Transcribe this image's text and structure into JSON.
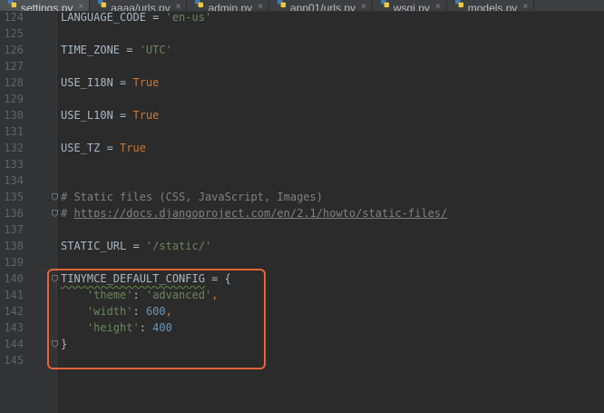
{
  "tabs": [
    {
      "label": "settings.py",
      "active": true
    },
    {
      "label": "aaaa/urls.py",
      "active": false
    },
    {
      "label": "admin.py",
      "active": false
    },
    {
      "label": "app01/urls.py",
      "active": false
    },
    {
      "label": "wsgi.py",
      "active": false
    },
    {
      "label": "models.py",
      "active": false
    }
  ],
  "close_glyph": "×",
  "editor": {
    "lines": [
      {
        "n": "124",
        "tokens": [
          [
            "ident",
            "LANGUAGE_CODE = "
          ],
          [
            "str",
            "'en-us'"
          ]
        ]
      },
      {
        "n": "125",
        "tokens": []
      },
      {
        "n": "126",
        "tokens": [
          [
            "ident",
            "TIME_ZONE = "
          ],
          [
            "str",
            "'UTC'"
          ]
        ]
      },
      {
        "n": "127",
        "tokens": []
      },
      {
        "n": "128",
        "tokens": [
          [
            "ident",
            "USE_I18N = "
          ],
          [
            "kw",
            "True"
          ]
        ]
      },
      {
        "n": "129",
        "tokens": []
      },
      {
        "n": "130",
        "tokens": [
          [
            "ident",
            "USE_L10N = "
          ],
          [
            "kw",
            "True"
          ]
        ]
      },
      {
        "n": "131",
        "tokens": []
      },
      {
        "n": "132",
        "tokens": [
          [
            "ident",
            "USE_TZ = "
          ],
          [
            "kw",
            "True"
          ]
        ]
      },
      {
        "n": "133",
        "tokens": []
      },
      {
        "n": "134",
        "tokens": []
      },
      {
        "n": "135",
        "fold": true,
        "tokens": [
          [
            "cmt",
            "# Static files (CSS, JavaScript, Images)"
          ]
        ]
      },
      {
        "n": "136",
        "fold": true,
        "tokens": [
          [
            "cmt",
            "# "
          ],
          [
            "link",
            "https://docs.djangoproject.com/en/2.1/howto/static-files/"
          ]
        ]
      },
      {
        "n": "137",
        "tokens": []
      },
      {
        "n": "138",
        "tokens": [
          [
            "ident",
            "STATIC_URL = "
          ],
          [
            "str",
            "'/static/'"
          ]
        ]
      },
      {
        "n": "139",
        "tokens": []
      },
      {
        "n": "140",
        "fold": true,
        "tokens": [
          [
            "squiggle",
            "TINYMCE_DEFAULT_CONFIG"
          ],
          [
            "ident",
            " = {"
          ]
        ]
      },
      {
        "n": "141",
        "tokens": [
          [
            "ident",
            "    "
          ],
          [
            "str",
            "'theme'"
          ],
          [
            "ident",
            ": "
          ],
          [
            "str",
            "'advanced'"
          ],
          [
            "kw",
            ","
          ]
        ]
      },
      {
        "n": "142",
        "tokens": [
          [
            "ident",
            "    "
          ],
          [
            "str",
            "'width'"
          ],
          [
            "ident",
            ": "
          ],
          [
            "num",
            "600"
          ],
          [
            "kw",
            ","
          ]
        ]
      },
      {
        "n": "143",
        "tokens": [
          [
            "ident",
            "    "
          ],
          [
            "str",
            "'height'"
          ],
          [
            "ident",
            ": "
          ],
          [
            "num",
            "400"
          ]
        ]
      },
      {
        "n": "144",
        "fold": true,
        "tokens": [
          [
            "ident",
            "}"
          ]
        ]
      },
      {
        "n": "145",
        "tokens": []
      }
    ]
  },
  "colors": {
    "background": "#2b2b2b",
    "keyword": "#cc7832",
    "string": "#6a8759",
    "number": "#6897bb",
    "comment": "#808080",
    "highlight_box": "#e5633a"
  },
  "icons": {
    "tab_icon": "python-file-icon",
    "fold_marker": "fold-marker-icon"
  }
}
